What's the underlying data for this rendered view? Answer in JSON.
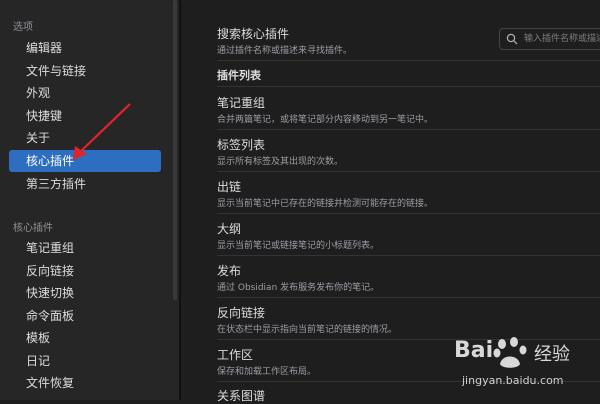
{
  "sidebar": {
    "options_title": "选项",
    "options_items": [
      "编辑器",
      "文件与链接",
      "外观",
      "快捷键",
      "关于",
      "核心插件",
      "第三方插件"
    ],
    "core_title": "核心插件",
    "core_items": [
      "笔记重组",
      "反向链接",
      "快速切换",
      "命令面板",
      "模板",
      "日记",
      "文件恢复"
    ]
  },
  "main": {
    "search_title": "搜索核心插件",
    "search_desc": "通过插件名称或描述来寻找插件。",
    "search_placeholder": "输入插件名称或描述",
    "list_title": "插件列表",
    "plugins": [
      {
        "name": "笔记重组",
        "desc": "合并两篇笔记，或将笔记部分内容移动到另一笔记中。"
      },
      {
        "name": "标签列表",
        "desc": "显示所有标签及其出现的次数。"
      },
      {
        "name": "出链",
        "desc": "显示当前笔记中已存在的链接并检测可能存在的链接。"
      },
      {
        "name": "大纲",
        "desc": "显示当前笔记或链接笔记的小标题列表。"
      },
      {
        "name": "发布",
        "desc": "通过 Obsidian 发布服务发布你的笔记。"
      },
      {
        "name": "反向链接",
        "desc": "在状态栏中显示指向当前笔记的链接的情况。"
      },
      {
        "name": "工作区",
        "desc": "保存和加载工作区布局。"
      },
      {
        "name": "关系图谱",
        "desc": ""
      }
    ]
  },
  "watermark": {
    "brand": "Bai",
    "brand2": "经验",
    "url": "jingyan.baidu.com"
  },
  "colors": {
    "accent": "#2d6ec0",
    "annotation_arrow": "#e0242b"
  }
}
